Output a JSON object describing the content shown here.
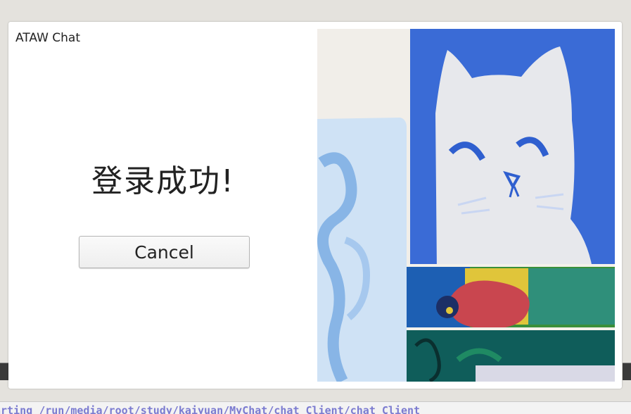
{
  "dialog": {
    "title": "ATAW Chat",
    "message": "登录成功!",
    "cancel_label": "Cancel",
    "image": {
      "icon": "cat-painting",
      "colors": {
        "wall": "#f1eee9",
        "blue_panel": "#3b6fd8",
        "cat": "#e6e7ea",
        "light_blue_paper": "#bfd8f2",
        "flower_red": "#c9464f",
        "yellow": "#d6c22f",
        "green": "#1f8a63",
        "teal": "#116b67"
      }
    }
  },
  "console": {
    "text": "arting /run/media/root/study/kaiyuan/MyChat/chat_Client/chat_Client"
  }
}
